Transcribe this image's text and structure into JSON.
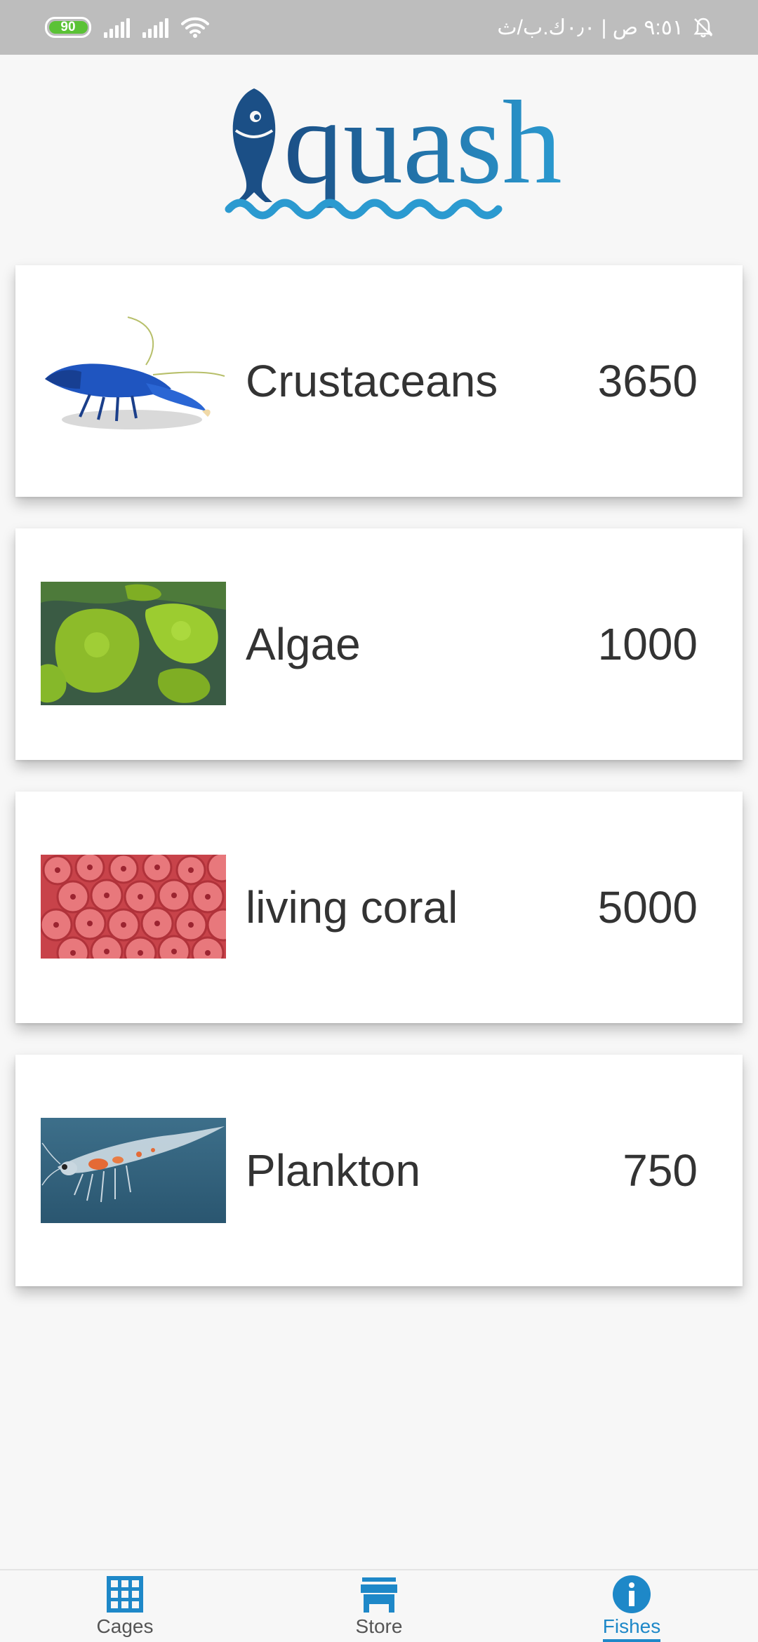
{
  "status_bar": {
    "battery": "90",
    "time_text": "٩:٥١ ص | ٠٫٠ك.ب/ث",
    "colors": {
      "background": "#bdbdbd",
      "battery": "#5bc236"
    },
    "icons": [
      "signal-icon",
      "signal-icon",
      "wifi-icon",
      "bell-off-icon"
    ]
  },
  "header": {
    "logo_text": "quash"
  },
  "items": [
    {
      "label": "Crustaceans",
      "price": "3650",
      "image": "blue-lobster"
    },
    {
      "label": "Algae",
      "price": "1000",
      "image": "green-algae"
    },
    {
      "label": "living coral",
      "price": "5000",
      "image": "red-coral"
    },
    {
      "label": "Plankton",
      "price": "750",
      "image": "krill-shrimp"
    }
  ],
  "bottom_nav": {
    "tabs": [
      {
        "label": "Cages",
        "icon": "grid-icon"
      },
      {
        "label": "Store",
        "icon": "store-icon"
      },
      {
        "label": "Fishes",
        "icon": "info-icon"
      }
    ],
    "active_tab": "Fishes",
    "accent_color": "#1e88c8"
  }
}
